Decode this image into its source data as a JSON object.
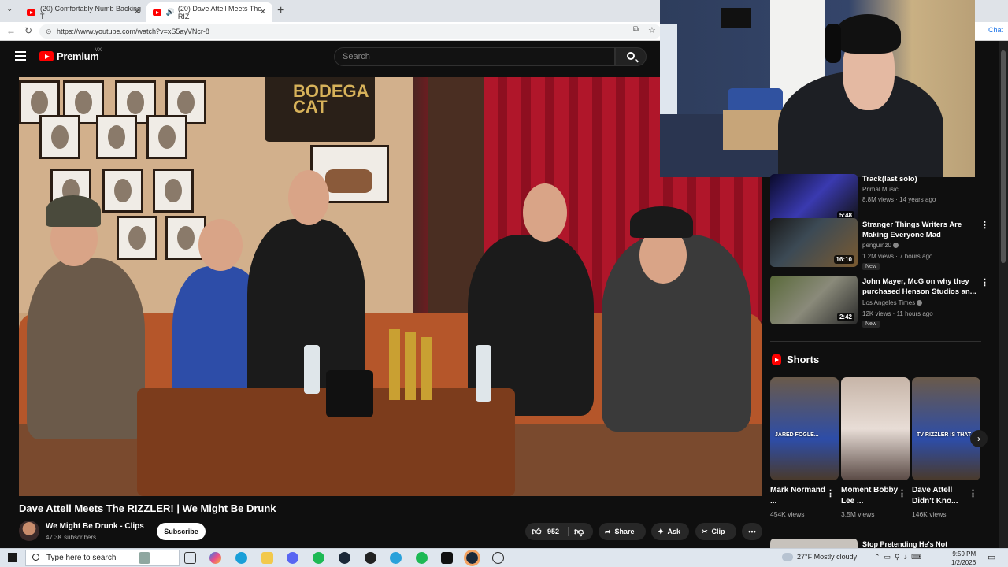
{
  "browser": {
    "tabs": [
      {
        "title": "(20) Comfortably Numb Backing T",
        "active": false
      },
      {
        "title": "(20) Dave Attell Meets The RIZ",
        "active": true
      }
    ],
    "new_tab": "+",
    "url": "https://www.youtube.com/watch?v=xS5ayVNcr-8",
    "chat_label": "Chat"
  },
  "youtube": {
    "logo_word": "Premium",
    "region": "MX",
    "search_placeholder": "Search"
  },
  "video": {
    "title": "Dave Attell Meets The RIZZLER! | We Might Be Drunk",
    "sign_text": "BODEGA CAT",
    "channel": "We Might Be Drunk - Clips",
    "subscribers": "47.3K subscribers",
    "subscribe_label": "Subscribe",
    "likes": "952",
    "share_label": "Share",
    "ask_label": "Ask",
    "clip_label": "Clip"
  },
  "sidebar": {
    "videos": [
      {
        "title": "Track(last solo)",
        "channel": "Primal Music",
        "meta": "8.8M views · 14 years ago",
        "duration": "5:48",
        "new": false
      },
      {
        "title": "Stranger Things Writers Are Making Everyone Mad",
        "channel": "penguinz0",
        "meta": "1.2M views · 7 hours ago",
        "duration": "16:10",
        "new": true,
        "new_label": "New"
      },
      {
        "title": "John Mayer, McG on why they purchased Henson Studios an...",
        "channel": "Los Angeles Times",
        "meta": "12K views · 11 hours ago",
        "duration": "2:42",
        "new": true,
        "new_label": "New"
      }
    ],
    "shorts_label": "Shorts",
    "shorts": [
      {
        "title": "Mark Normand ...",
        "views": "454K views",
        "caption": "JARED FOGLE..."
      },
      {
        "title": "Moment Bobby Lee ...",
        "views": "3.5M views",
        "caption": ""
      },
      {
        "title": "Dave Attell Didn't Kno...",
        "views": "146K views",
        "caption": "TV RIZZLER IS THAT"
      }
    ],
    "next_title": "Stop Pretending He's Not"
  },
  "taskbar": {
    "search_placeholder": "Type here to search",
    "weather": "27°F  Mostly cloudy",
    "time": "9:59 PM",
    "date": "1/2/2026"
  },
  "colors": {
    "yt_red": "#ff0000",
    "bg": "#0f0f0f",
    "pill": "#272727"
  }
}
